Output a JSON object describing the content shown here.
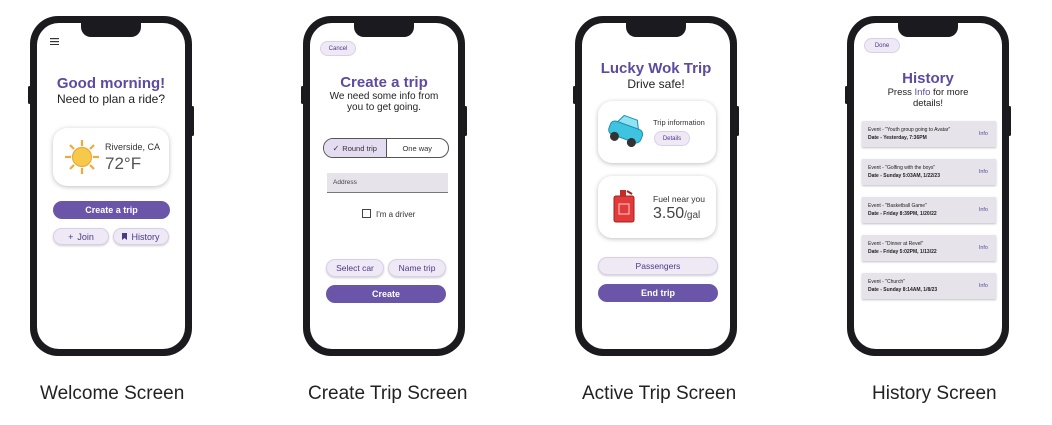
{
  "captions": [
    "Welcome Screen",
    "Create Trip Screen",
    "Active Trip Screen",
    "History Screen"
  ],
  "welcome": {
    "greeting": "Good morning!",
    "prompt": "Need to plan a ride?",
    "location": "Riverside, CA",
    "temperature": "72°F",
    "create_trip": "Create a trip",
    "join": "Join",
    "history": "History"
  },
  "create": {
    "cancel": "Cancel",
    "title": "Create a trip",
    "sub1": "We need some info from",
    "sub2": "you to get going.",
    "round_trip": "Round trip",
    "one_way": "One way",
    "address_placeholder": "Address",
    "driver_label": "I'm a driver",
    "select_car": "Select car",
    "name_trip": "Name trip",
    "create": "Create"
  },
  "active": {
    "title": "Lucky Wok Trip",
    "sub": "Drive safe!",
    "trip_info": "Trip information",
    "details": "Details",
    "fuel_label": "Fuel near you",
    "fuel_price": "3.50",
    "fuel_unit": "/gal",
    "passengers": "Passengers",
    "end_trip": "End trip"
  },
  "history": {
    "done": "Done",
    "title": "History",
    "sub_pre": "Press ",
    "sub_info": "Info",
    "sub_post": " for more",
    "sub2": "details!",
    "info_label": "Info",
    "rows": [
      {
        "event": "Event - \"Youth group going to Avatar\"",
        "date": "Date - Yesterday, 7:36PM"
      },
      {
        "event": "Event - \"Golfing with the boys\"",
        "date": "Date - Sunday 5:03AM, 1/22/23"
      },
      {
        "event": "Event - \"Basketball Game\"",
        "date": "Date - Friday 8:39PM, 1/20/22"
      },
      {
        "event": "Event - \"Dinner at Revel\"",
        "date": "Date - Friday 5:02PM, 1/13/22"
      },
      {
        "event": "Event - \"Church\"",
        "date": "Date - Sunday 8:14AM, 1/8/23"
      }
    ]
  }
}
